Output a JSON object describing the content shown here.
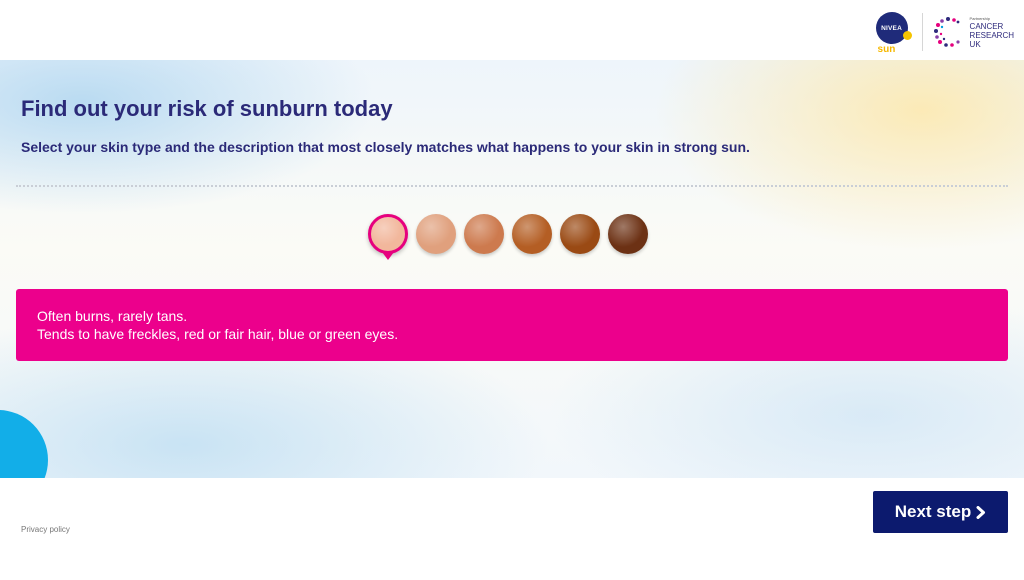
{
  "header": {
    "nivea_logo_text": "NIVEA",
    "nivea_sun_text": "sun",
    "partner_small_text": "Partnership",
    "cruk_lines": [
      "CANCER",
      "RESEARCH",
      "UK"
    ]
  },
  "main": {
    "title": "Find out your risk of sunburn today",
    "subtitle": "Select your skin type and the description that most closely matches what happens to your skin in strong sun.",
    "swatches": [
      {
        "color": "#f2b79c",
        "selected": true
      },
      {
        "color": "#e0a07d",
        "selected": false
      },
      {
        "color": "#cd7a4e",
        "selected": false
      },
      {
        "color": "#b45e24",
        "selected": false
      },
      {
        "color": "#9a4a14",
        "selected": false
      },
      {
        "color": "#6c3114",
        "selected": false
      }
    ],
    "description": {
      "line1": "Often burns, rarely tans.",
      "line2": "Tends to have freckles, red or fair hair, blue or green eyes."
    }
  },
  "footer": {
    "privacy_label": "Privacy policy",
    "next_label": "Next step",
    "next_icon": "chevron-right-icon"
  },
  "colors": {
    "brand_navy": "#2b2a78",
    "accent_pink": "#ec008c",
    "button_navy": "#0c1a6e",
    "corner_blue": "#12aee8"
  }
}
